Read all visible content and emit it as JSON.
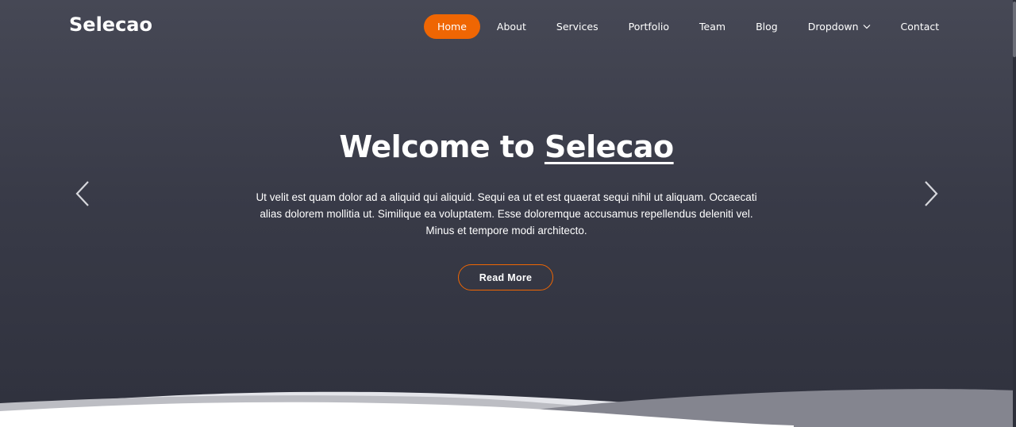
{
  "header": {
    "logo": "Selecao",
    "nav": [
      {
        "label": "Home",
        "active": true
      },
      {
        "label": "About"
      },
      {
        "label": "Services"
      },
      {
        "label": "Portfolio"
      },
      {
        "label": "Team"
      },
      {
        "label": "Blog"
      },
      {
        "label": "Dropdown",
        "has_dropdown": true
      },
      {
        "label": "Contact"
      }
    ]
  },
  "hero": {
    "title_prefix": "Welcome to",
    "title_brand": "Selecao",
    "description": "Ut velit est quam dolor ad a aliquid qui aliquid. Sequi ea ut et est quaerat sequi nihil ut aliquam. Occaecati alias dolorem mollitia ut. Similique ea voluptatem. Esse doloremque accusamus repellendus deleniti vel. Minus et tempore modi architecto.",
    "cta_label": "Read More",
    "prev_icon": "chevron-left-icon",
    "next_icon": "chevron-right-icon"
  },
  "colors": {
    "accent": "#ef6603",
    "background_top": "#464855",
    "background_bottom": "#2f313d",
    "text": "#ffffff"
  }
}
